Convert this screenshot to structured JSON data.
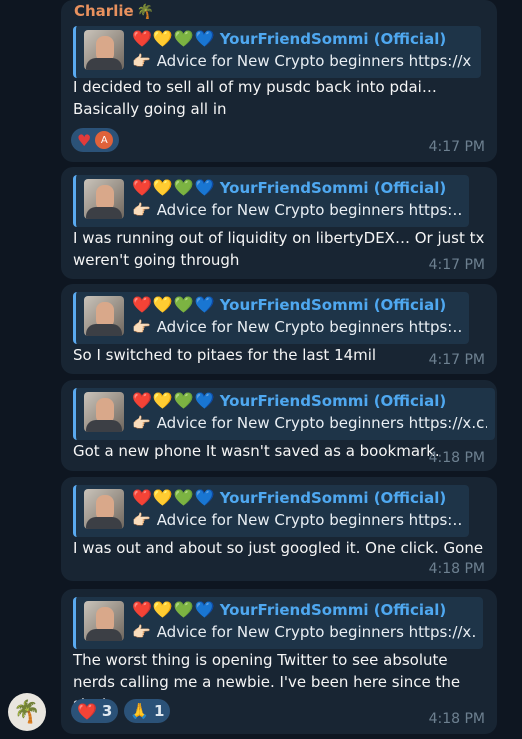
{
  "chat": {
    "sender": "Charlie",
    "sender_emoji": "🌴",
    "reply": {
      "hearts": [
        "❤️",
        "💛",
        "💚",
        "💙"
      ],
      "name": "YourFriendSommi (Official)",
      "hand": "👉🏻"
    },
    "messages": [
      {
        "reply_snippet": "Advice for New Crypto beginners  https://x…",
        "text": "I decided to sell all of my pusdc back into pdai… Basically going all in",
        "time": "4:17 PM",
        "reactions": [
          {
            "emoji": "heart",
            "count": "",
            "avatar_letter": "A"
          }
        ]
      },
      {
        "reply_snippet": "Advice for New Crypto beginners  https:…",
        "text": "I was running out of liquidity on libertyDEX… Or just tx weren't going through",
        "time": "4:17 PM"
      },
      {
        "reply_snippet": "Advice for New Crypto beginners  https:…",
        "text": "So I switched to pitaes for the last 14mil",
        "time": "4:17 PM"
      },
      {
        "reply_snippet": "Advice for New Crypto beginners  https://x.c…",
        "text": "Got a new phone It wasn't saved as a bookmark.",
        "time": "4:18 PM"
      },
      {
        "reply_snippet": "Advice for New Crypto beginners  https:…",
        "text": "I was out and about so just googled it. One click. Gone",
        "time": "4:18 PM"
      },
      {
        "reply_snippet": "Advice for New Crypto beginners  https://x…",
        "text": "The worst thing is opening Twitter to see absolute nerds calling me a newbie. I've been here since the start",
        "time": "4:18 PM",
        "reactions": [
          {
            "emoji": "❤️",
            "count": "3"
          },
          {
            "emoji": "🙏",
            "count": "1"
          }
        ]
      }
    ]
  },
  "colors": {
    "background": "#0e1621",
    "bubble": "#182533",
    "reply_bg": "#1e3448",
    "reply_bar": "#5aaaf0",
    "sender": "#e8915e",
    "reply_name": "#4fa8f0",
    "time": "#6d8090",
    "reaction_bg": "#2b5278"
  },
  "icons": [
    "palm-tree-icon",
    "pointing-hand-icon",
    "heart-icon",
    "pray-icon",
    "user-avatar"
  ]
}
